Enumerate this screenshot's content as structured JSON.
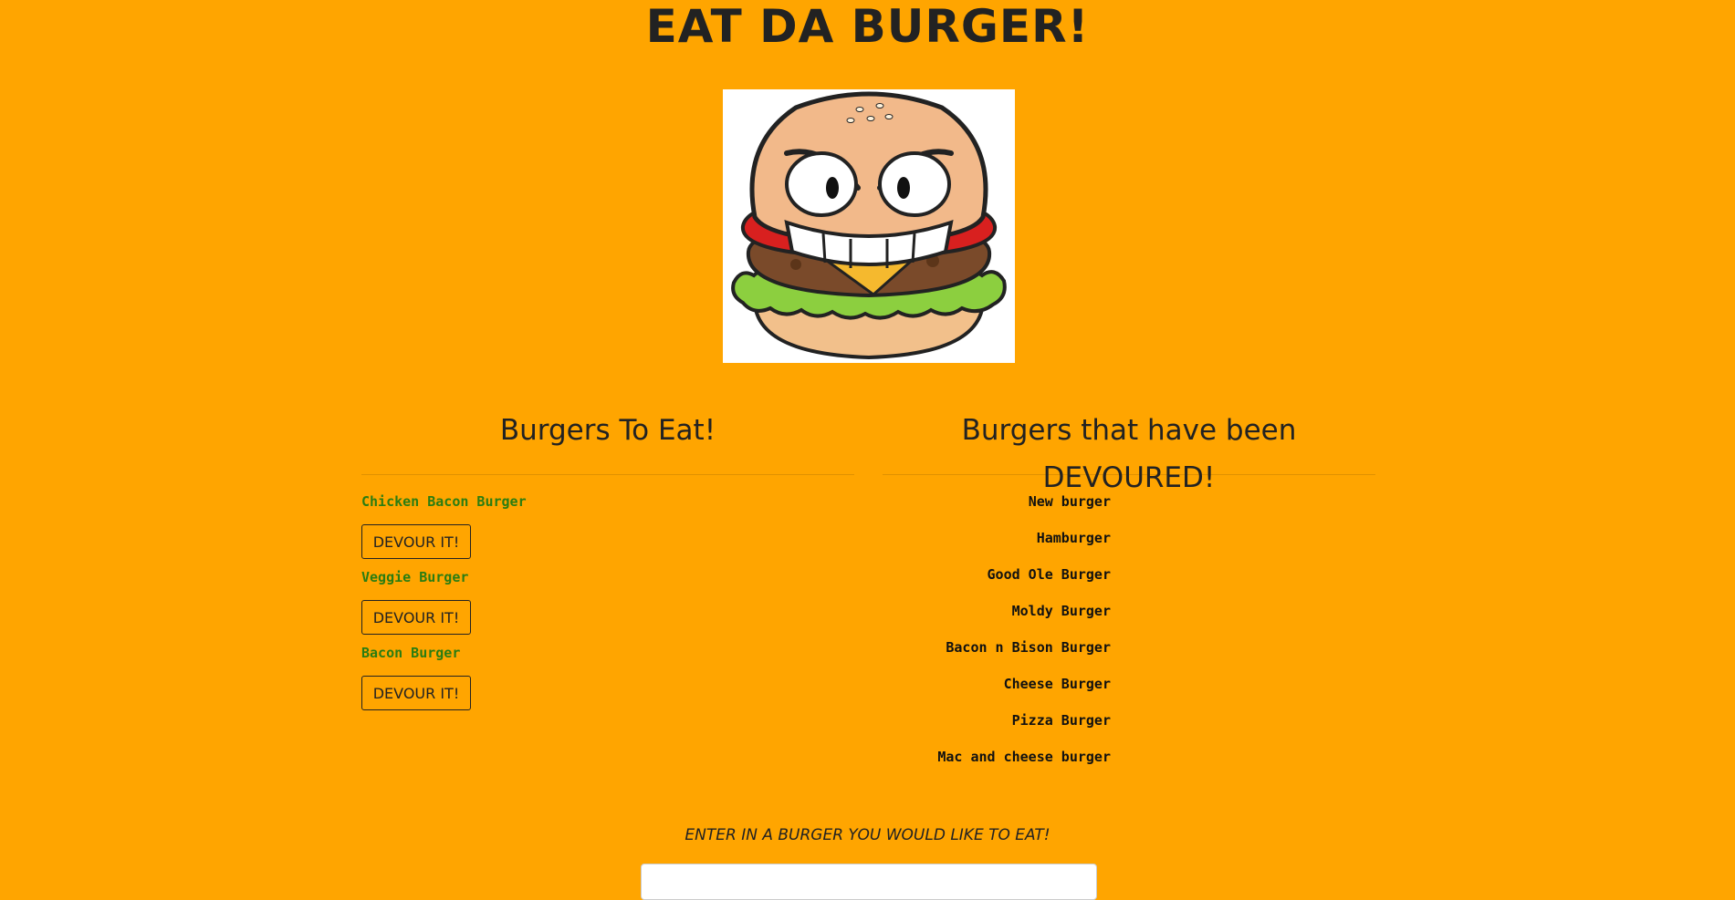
{
  "header": {
    "title": "EAT DA BURGER!"
  },
  "hero_image": {
    "icon": "angry-burger-icon"
  },
  "to_eat": {
    "heading": "Burgers To Eat!",
    "button_label": "DEVOUR IT!",
    "items": [
      {
        "name": "Chicken Bacon Burger"
      },
      {
        "name": "Veggie Burger"
      },
      {
        "name": "Bacon Burger"
      }
    ]
  },
  "devoured": {
    "heading": "Burgers that have been DEVOURED!",
    "items": [
      {
        "name": "New burger"
      },
      {
        "name": "Hamburger"
      },
      {
        "name": "Good Ole Burger"
      },
      {
        "name": "Moldy Burger"
      },
      {
        "name": "Bacon n Bison Burger"
      },
      {
        "name": "Cheese Burger"
      },
      {
        "name": "Pizza Burger"
      },
      {
        "name": "Mac and cheese burger"
      }
    ]
  },
  "form": {
    "prompt": "ENTER IN A BURGER YOU WOULD LIKE TO EAT!",
    "input_value": ""
  },
  "colors": {
    "background": "#FFA500",
    "to_eat_text": "#2a7d12",
    "text": "#222222"
  }
}
